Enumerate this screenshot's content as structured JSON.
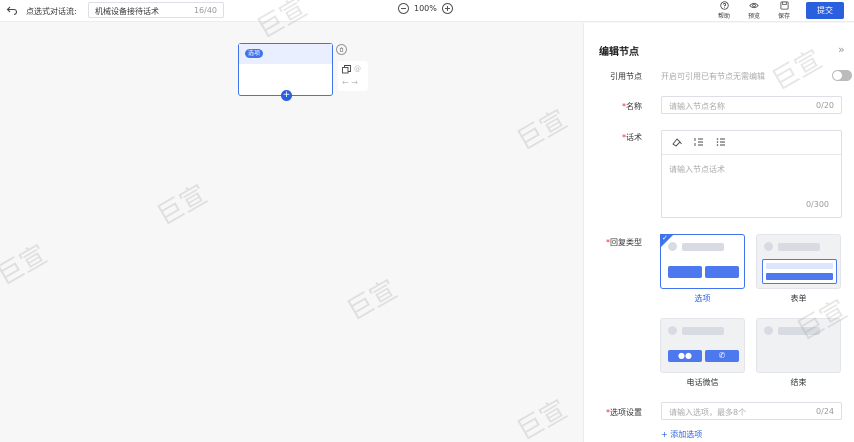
{
  "topbar": {
    "flow_label": "点选式对话流:",
    "flow_name": "机械设备接待话术",
    "flow_count": "16/40",
    "zoom": "100%",
    "help": "帮助",
    "preview": "预览",
    "save": "保存",
    "submit": "提交"
  },
  "node": {
    "tag": "选项"
  },
  "panel": {
    "title": "编辑节点",
    "ref_label": "引用节点",
    "ref_hint": "开启可引用已有节点无需编辑",
    "name_label": "名称",
    "name_placeholder": "请输入节点名称",
    "name_count": "0/20",
    "script_label": "话术",
    "script_placeholder": "请输入节点话术",
    "script_count": "0/300",
    "reply_label": "回复类型",
    "types": {
      "option": "选项",
      "form": "表单",
      "phone": "电话微信",
      "end": "结束"
    },
    "option_label": "选项设置",
    "option_placeholder": "请输入选项，最多8个",
    "option_count": "0/24",
    "add_option": "+ 添加选项"
  },
  "watermark": "巨宣",
  "colors": {
    "accent": "#2a5fdd",
    "required": "#e22233"
  }
}
